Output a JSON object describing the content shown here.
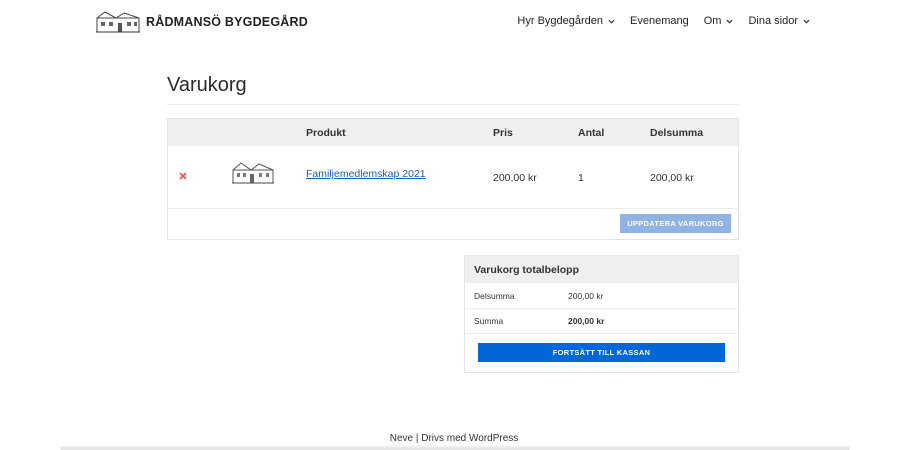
{
  "brand": {
    "name": "RÅDMANSÖ BYGDEGÅRD",
    "logo_icon": "house-sketch-logo"
  },
  "nav": {
    "items": [
      {
        "label": "Hyr Bygdegården",
        "has_dropdown": true
      },
      {
        "label": "Evenemang",
        "has_dropdown": false
      },
      {
        "label": "Om",
        "has_dropdown": true
      },
      {
        "label": "Dina sidor",
        "has_dropdown": true
      }
    ]
  },
  "page": {
    "title": "Varukorg"
  },
  "cart": {
    "headers": {
      "product": "Produkt",
      "price": "Pris",
      "quantity": "Antal",
      "subtotal": "Delsumma"
    },
    "items": [
      {
        "name": "Familjemedlemskap 2021",
        "price": "200,00 kr",
        "quantity": "1",
        "subtotal": "200,00 kr",
        "thumb_icon": "house-sketch-thumbnail"
      }
    ],
    "update_label": "UPPDATERA VARUKORG",
    "remove_color": "#e04d4d"
  },
  "totals": {
    "title": "Varukorg totalbelopp",
    "rows": [
      {
        "label": "Delsumma",
        "value": "200,00 kr"
      },
      {
        "label": "Summa",
        "value": "200,00 kr"
      }
    ],
    "checkout_label": "FORTSÄTT TILL KASSAN"
  },
  "footer": {
    "text": "Neve | Drivs med WordPress"
  },
  "colors": {
    "primary": "#0066d9",
    "primary_light": "#8fb4e4",
    "link": "#1a5fb4",
    "header_bg": "#efefef"
  }
}
